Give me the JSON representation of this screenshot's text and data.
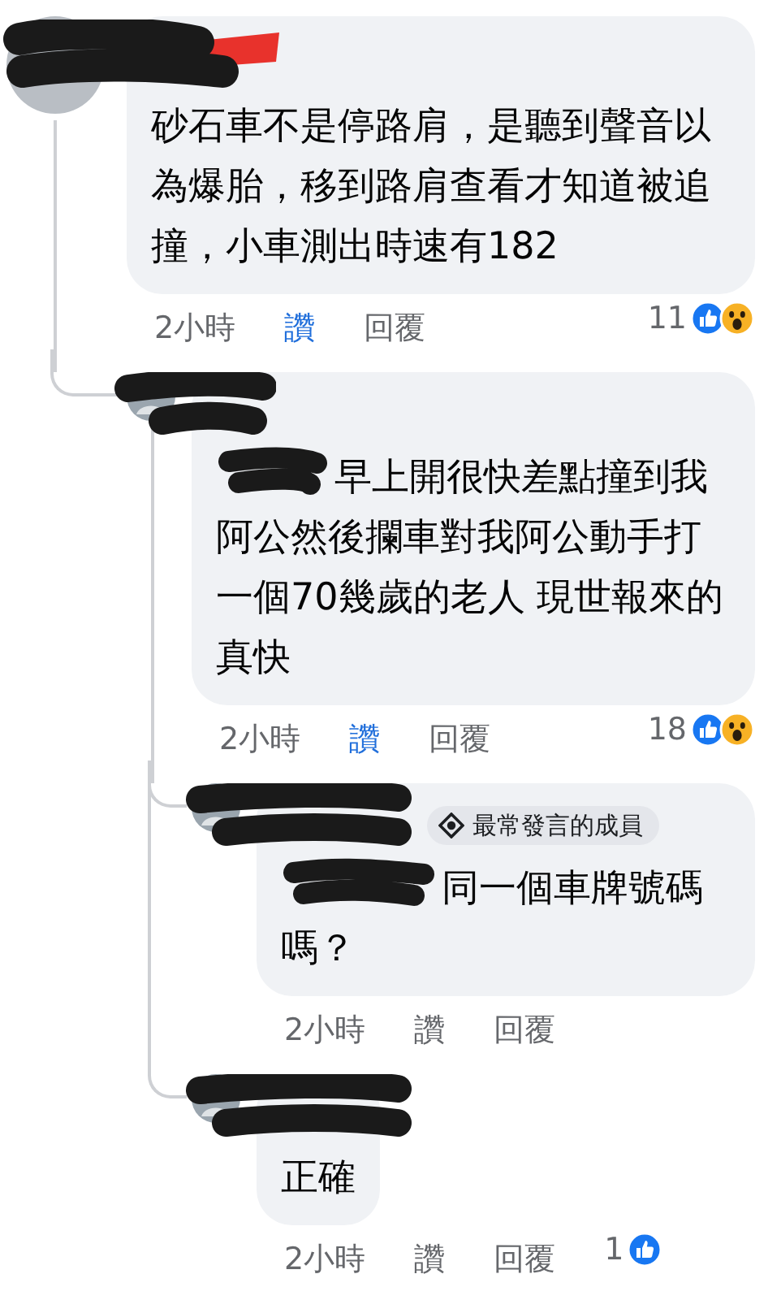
{
  "comments": [
    {
      "redacted": true,
      "text_lead_redacted": false,
      "text": "砂石車不是停路肩，是聽到聲音以為爆胎，移到路肩查看才知道被追撞，小車測出時速有182",
      "time": "2小時",
      "like_label": "讚",
      "liked": true,
      "reply_label": "回覆",
      "reaction_count": "11",
      "reactions": [
        {
          "kind": "like"
        },
        {
          "kind": "wow"
        }
      ],
      "replies": [
        {
          "redacted": true,
          "text_lead_redacted": true,
          "text": "早上開很快差點撞到我阿公然後攔車對我阿公動手打一個70幾歲的老人 現世報來的真快",
          "time": "2小時",
          "like_label": "讚",
          "liked": true,
          "reply_label": "回覆",
          "reaction_count": "18",
          "reactions": [
            {
              "kind": "like"
            },
            {
              "kind": "wow"
            }
          ],
          "replies": [
            {
              "redacted": true,
              "text_lead_redacted": true,
              "badge": "最常發言的成員",
              "text": "同一個車牌號碼嗎？",
              "time": "2小時",
              "like_label": "讚",
              "liked": false,
              "reply_label": "回覆"
            },
            {
              "redacted": true,
              "text_lead_redacted": false,
              "text": "正確",
              "time": "2小時",
              "like_label": "讚",
              "liked": false,
              "reply_label": "回覆",
              "reaction_count": "1",
              "reactions": [
                {
                  "kind": "like"
                }
              ]
            }
          ]
        }
      ]
    }
  ]
}
